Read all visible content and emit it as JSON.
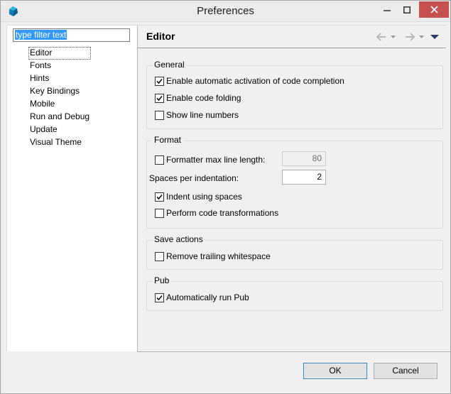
{
  "window": {
    "title": "Preferences",
    "controls": {
      "minimize": "–",
      "maximize": "□",
      "close": "✕"
    }
  },
  "sidebar": {
    "filter_value": "type filter text",
    "items": [
      {
        "label": "Editor",
        "selected": true
      },
      {
        "label": "Fonts"
      },
      {
        "label": "Hints"
      },
      {
        "label": "Key Bindings"
      },
      {
        "label": "Mobile"
      },
      {
        "label": "Run and Debug"
      },
      {
        "label": "Update"
      },
      {
        "label": "Visual Theme"
      }
    ]
  },
  "main": {
    "title": "Editor",
    "nav_icons": [
      "back-arrow-icon",
      "forward-arrow-icon",
      "view-menu-icon"
    ],
    "general": {
      "label": "General",
      "options": [
        {
          "label": "Enable automatic activation of code completion",
          "checked": true
        },
        {
          "label": "Enable code folding",
          "checked": true
        },
        {
          "label": "Show line numbers",
          "checked": false
        }
      ]
    },
    "format": {
      "label": "Format",
      "max_line_length": {
        "label": "Formatter max line length:",
        "checked": false,
        "value": "80",
        "enabled": false
      },
      "spaces_per_indent": {
        "label": "Spaces per indentation:",
        "value": "2"
      },
      "indent_spaces": {
        "label": "Indent using spaces",
        "checked": true
      },
      "code_transform": {
        "label": "Perform code transformations",
        "checked": false
      }
    },
    "save_actions": {
      "label": "Save actions",
      "remove_whitespace": {
        "label": "Remove trailing whitespace",
        "checked": false
      }
    },
    "pub": {
      "label": "Pub",
      "auto_run": {
        "label": "Automatically run Pub",
        "checked": true
      }
    }
  },
  "buttons": {
    "ok": "OK",
    "cancel": "Cancel"
  },
  "colors": {
    "accent": "#3399ff",
    "close_button": "#c75050"
  }
}
